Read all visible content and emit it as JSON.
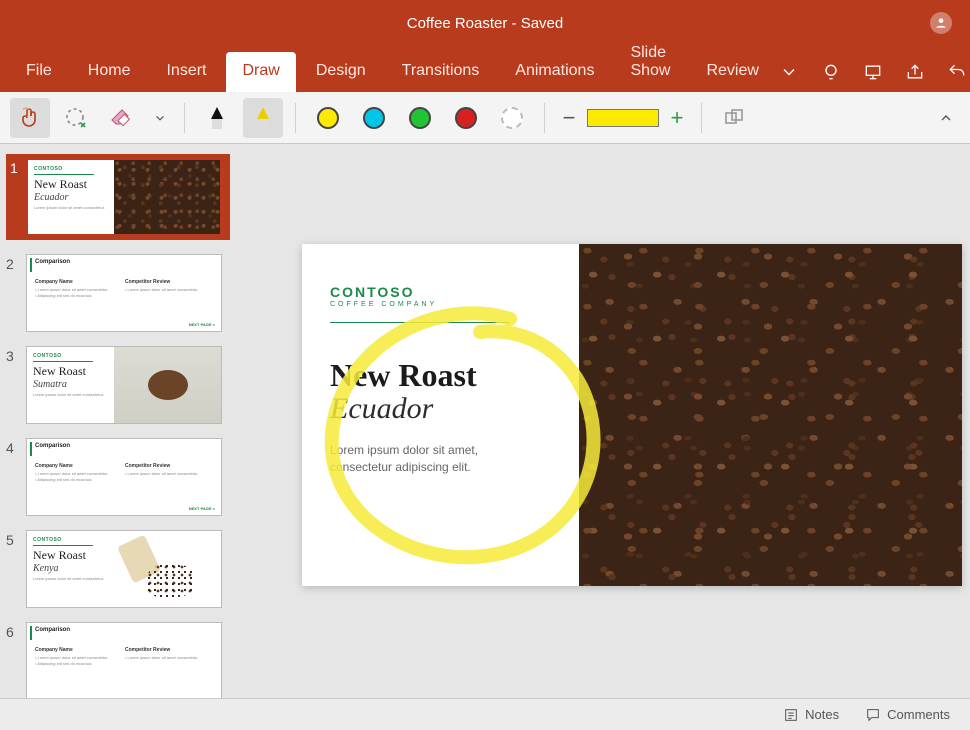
{
  "app": {
    "title": "Coffee Roaster - Saved"
  },
  "tabs": {
    "file": "File",
    "home": "Home",
    "insert": "Insert",
    "draw": "Draw",
    "design": "Design",
    "transitions": "Transitions",
    "animations": "Animations",
    "slideshow": "Slide Show",
    "review": "Review",
    "active": "draw"
  },
  "ribbon": {
    "colors": [
      "yellow",
      "cyan",
      "green",
      "red",
      "none"
    ],
    "thickness_color": "#feea00"
  },
  "thumbnails": [
    {
      "n": "1",
      "layout": "title-beans",
      "title": "New Roast",
      "sub": "Ecuador"
    },
    {
      "n": "2",
      "layout": "comparison",
      "head": "Comparison",
      "company": "Company Name",
      "col2": "Competitor Review",
      "next": "NEXT PAGE >"
    },
    {
      "n": "3",
      "layout": "title-hands",
      "title": "New Roast",
      "sub": "Sumatra"
    },
    {
      "n": "4",
      "layout": "comparison",
      "head": "Comparison",
      "company": "Company Name",
      "col2": "Competitor Review",
      "next": "NEXT PAGE >"
    },
    {
      "n": "5",
      "layout": "title-spill",
      "title": "New Roast",
      "sub": "Kenya"
    },
    {
      "n": "6",
      "layout": "comparison",
      "head": "Comparison",
      "company": "Company Name",
      "col2": "Competitor Review"
    }
  ],
  "slide": {
    "brand": "CONTOSO",
    "brand_sub": "COFFEE COMPANY",
    "title": "New Roast",
    "sub": "Ecuador",
    "body": "Lorem ipsum dolor sit amet, consectetur adipiscing elit."
  },
  "status": {
    "notes": "Notes",
    "comments": "Comments"
  }
}
